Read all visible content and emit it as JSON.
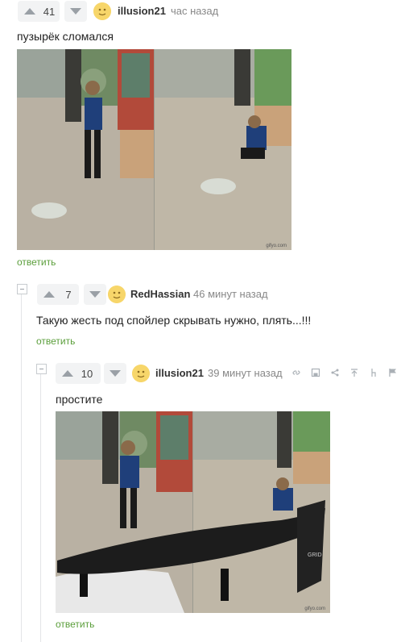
{
  "comments": [
    {
      "rating": "41",
      "username": "illusion21",
      "time": "час назад",
      "text": "пузырёк сломался",
      "reply_label": "ответить",
      "image": {
        "watermark": "gifyo.com"
      }
    },
    {
      "rating": "7",
      "username": "RedHassian",
      "time": "46 минут назад",
      "text": "Такую жесть под спойлер скрывать нужно, плять...!!!",
      "reply_label": "ответить"
    },
    {
      "rating": "10",
      "username": "illusion21",
      "time": "39 минут назад",
      "text": "простите",
      "reply_label": "ответить",
      "image": {
        "watermark": "gifyo.com",
        "spoiler_text": "GRID"
      }
    }
  ],
  "colors": {
    "reply": "#5a9e3a",
    "vote_bg": "#f2f3f4",
    "avatar": "#f7d66a"
  }
}
